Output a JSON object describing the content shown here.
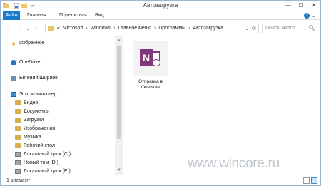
{
  "window": {
    "title": "Автозагрузка",
    "controls": {
      "minimize": "—",
      "maximize": "☐",
      "close": "✕"
    }
  },
  "ribbon": {
    "tabs": [
      "Файл",
      "Главная",
      "Поделиться",
      "Вид"
    ],
    "expand_glyph": "⌄",
    "help_glyph": "?"
  },
  "address_bar": {
    "overflow": "«",
    "path": [
      "Microsoft",
      "Windows",
      "Главное меню",
      "Программы",
      "Автозагрузка"
    ],
    "separator": "›",
    "dropdown_glyph": "⌄",
    "refresh_glyph": "⟳"
  },
  "search": {
    "placeholder": "Поиск: Автоз...",
    "icon": "search-icon"
  },
  "nav_glyphs": {
    "back": "←",
    "forward": "→",
    "recent": "⌄",
    "up": "↑"
  },
  "nav_pane": {
    "favorites": "Избранное",
    "onedrive": "OneDrive",
    "user": "Евгений Ширяев",
    "this_pc": "Этот компьютер",
    "pc_items": [
      "Видео",
      "Документы",
      "Загрузки",
      "Изображения",
      "Музыка",
      "Рабочий стол",
      "Локальный диск (C:)",
      "Новый том (D:)",
      "Локальный диск (E:)"
    ]
  },
  "content": {
    "items": [
      {
        "label_line1": "Отправка в",
        "label_line2": "OneNote",
        "icon": "onenote-icon"
      }
    ]
  },
  "status_bar": {
    "count": "1 элемент"
  },
  "watermark": "www.wincore.ru",
  "colors": {
    "file_tab": "#1979ca",
    "onenote": "#80397b",
    "folder": "#e9c66a"
  }
}
